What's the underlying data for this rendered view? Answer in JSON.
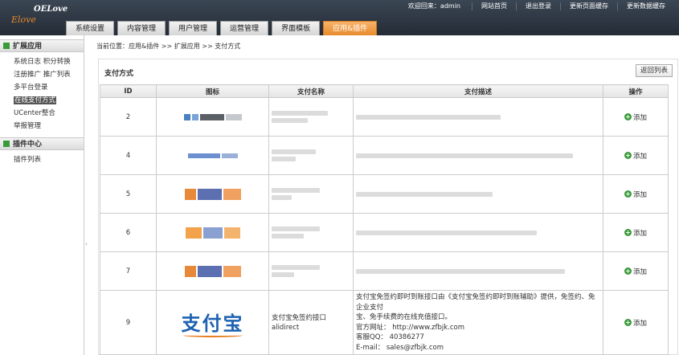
{
  "header": {
    "logo_main": "OELove",
    "logo_sub": "Elove",
    "welcome": "欢迎回来：admin",
    "links": [
      "网站首页",
      "退出登录",
      "更新页面缓存",
      "更新数据缓存"
    ],
    "tabs": [
      {
        "label": "系统设置",
        "active": false
      },
      {
        "label": "内容管理",
        "active": false
      },
      {
        "label": "用户管理",
        "active": false
      },
      {
        "label": "运营管理",
        "active": false
      },
      {
        "label": "界面模板",
        "active": false
      },
      {
        "label": "应用&插件",
        "active": true
      }
    ]
  },
  "sidebar": {
    "sections": [
      {
        "title": "扩展应用",
        "items": [
          {
            "label": "系统日志  积分转换",
            "active": false
          },
          {
            "label": "注册推广  推广列表",
            "active": false
          },
          {
            "label": "多平台登录",
            "active": false
          },
          {
            "label": "在线支付方式",
            "active": true
          },
          {
            "label": "UCenter整合",
            "active": false
          },
          {
            "label": "举报管理",
            "active": false
          }
        ]
      },
      {
        "title": "插件中心",
        "items": [
          {
            "label": "插件列表",
            "active": false
          }
        ]
      }
    ]
  },
  "main": {
    "breadcrumb": "当前位置：应用&插件  >>  扩展应用  >>  支付方式",
    "panel_title": "支付方式",
    "back_button": "返回列表",
    "columns": [
      "ID",
      "图标",
      "支付名称",
      "支付描述",
      "操作"
    ],
    "rows": [
      {
        "id": "2",
        "op": "添加"
      },
      {
        "id": "4",
        "op": "添加"
      },
      {
        "id": "5",
        "op": "添加"
      },
      {
        "id": "6",
        "op": "添加"
      },
      {
        "id": "7",
        "op": "添加"
      }
    ],
    "last_row": {
      "id": "9",
      "logo_text": "支付宝",
      "name_line1": "支付宝免签约接口",
      "name_line2": "alidirect",
      "desc_line1": "支付宝免签约即时到账接口由《支付宝免签约即时到账辅助》提供，免签约、免企业支付",
      "desc_line2": "宝、免手续费的在线充值接口。",
      "desc_line3": "官方网址：  http://www.zfbjk.com",
      "desc_line4": "客服QQ：  40386277",
      "desc_line5": "E-mail：  sales@zfbjk.com",
      "op": "添加"
    }
  }
}
